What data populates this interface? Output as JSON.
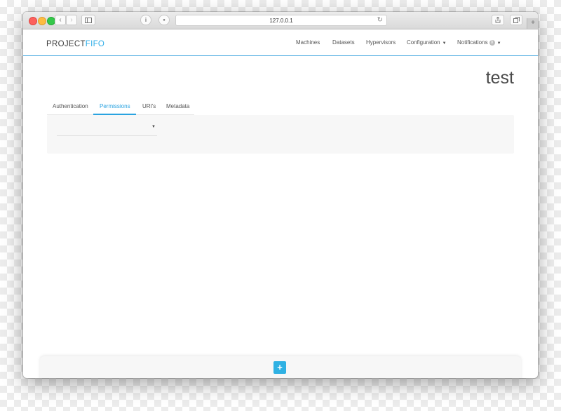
{
  "browser": {
    "url": "127.0.0.1",
    "icons": {
      "back": "chevron-left-icon",
      "forward": "chevron-right-icon",
      "sidebar": "sidebar-icon",
      "info": "info-icon",
      "extension": "extension-icon",
      "reload": "reload-icon",
      "share": "share-icon",
      "tabs": "tabs-icon"
    }
  },
  "nav": {
    "logo_part1": "PROJECT",
    "logo_part2": "FIFO",
    "links": [
      "Machines",
      "Datasets",
      "Hypervisors",
      "Configuration",
      "Notifications"
    ],
    "notifications_count": "0"
  },
  "page": {
    "title": "test",
    "tabs": [
      "Authentication",
      "Permissions",
      "URI's",
      "Metadata"
    ],
    "active_tab": "Permissions",
    "select_value": ""
  },
  "footer": {
    "add_label": "+"
  },
  "colors": {
    "accent": "#2fb1e3",
    "logo_dark": "#3c3c3c",
    "logo_blue": "#30aee8"
  }
}
